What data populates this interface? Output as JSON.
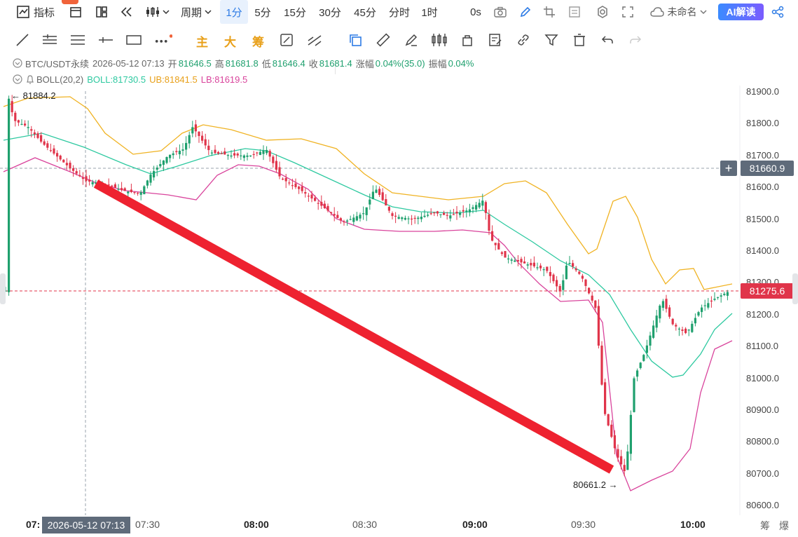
{
  "toolbar": {
    "indicator_label": "指标",
    "period_label": "周期",
    "intervals": [
      "1分",
      "5分",
      "15分",
      "30分",
      "45分",
      "分时",
      "1时"
    ],
    "active_interval": "1分",
    "countdown": "0s",
    "layout_name": "未命名",
    "ai_label": "AI解读"
  },
  "drawing_tools": {
    "main_label": "主",
    "big_label": "大",
    "chip_label": "筹"
  },
  "info": {
    "symbol": "BTC/USDT永续",
    "datetime": "2026-05-12 07:13",
    "open_label": "开",
    "open": "81646.5",
    "high_label": "高",
    "high": "81681.8",
    "low_label": "低",
    "low": "81646.4",
    "close_label": "收",
    "close": "81681.4",
    "change_label": "涨幅",
    "change": "0.04%(35.0)",
    "amp_label": "振幅",
    "amp": "0.04%"
  },
  "boll": {
    "name": "BOLL(20,2)",
    "mid": "BOLL:81730.5",
    "ub": "UB:81841.5",
    "lb": "LB:81619.5"
  },
  "axis": {
    "y_ticks": [
      "81900.0",
      "81800.0",
      "81700.0",
      "81600.0",
      "81500.0",
      "81400.0",
      "81300.0",
      "81200.0",
      "81100.0",
      "81000.0",
      "80900.0",
      "80800.0",
      "80700.0",
      "80600.0"
    ],
    "x_ticks": [
      "07:30",
      "08:00",
      "08:30",
      "09:00",
      "09:30",
      "10:00"
    ],
    "x_start_partial": "07:",
    "crosshair_time": "2026-05-12 07:13",
    "crosshair_price": "81660.9",
    "last_price": "81275.6"
  },
  "annotations": {
    "high_mark": "81884.2",
    "low_mark": "80661.2"
  },
  "footer": {
    "chip_label": "筹",
    "explode_label": "爆"
  },
  "colors": {
    "up": "#1fa06e",
    "down": "#e0344a",
    "ub": "#f0b323",
    "mid": "#2dc9a0",
    "lb": "#d9449c",
    "accent": "#2d7be5",
    "drawn_line": "#ee2230"
  }
}
